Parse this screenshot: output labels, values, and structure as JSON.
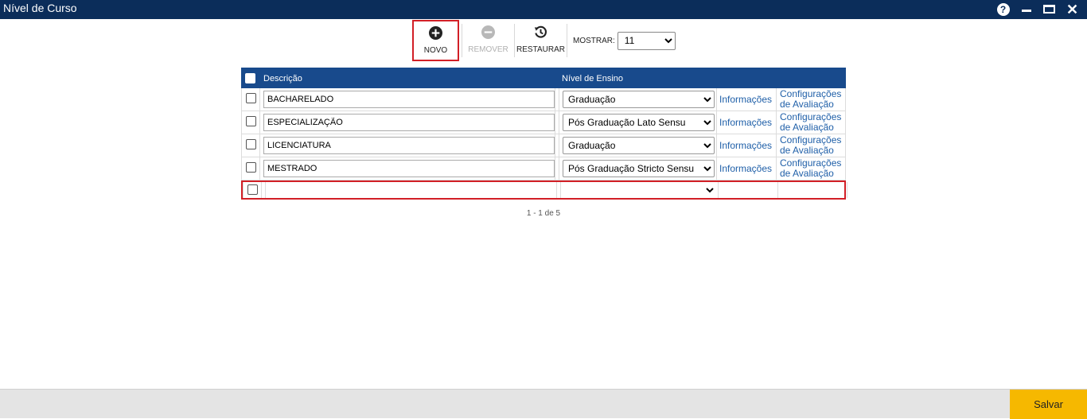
{
  "window": {
    "title": "Nível de Curso",
    "controls": [
      "help-icon",
      "minimize-icon",
      "restore-icon",
      "close-icon"
    ],
    "help_glyph": "?",
    "close_glyph": "✕"
  },
  "toolbar": {
    "new_label": "NOVO",
    "remove_label": "REMOVER",
    "restore_label": "RESTAURAR",
    "show_label": "MOSTRAR:",
    "show_value": "11"
  },
  "grid": {
    "headers": {
      "description": "Descrição",
      "level": "Nível de Ensino"
    },
    "rows": [
      {
        "description": "BACHARELADO",
        "level": "Graduação",
        "info": "Informações",
        "config": "Configurações de Avaliação"
      },
      {
        "description": "ESPECIALIZAÇÃO",
        "level": "Pós Graduação Lato Sensu",
        "info": "Informações",
        "config": "Configurações de Avaliação"
      },
      {
        "description": "LICENCIATURA",
        "level": "Graduação",
        "info": "Informações",
        "config": "Configurações de Avaliação"
      },
      {
        "description": "MESTRADO",
        "level": "Pós Graduação Stricto Sensu",
        "info": "Informações",
        "config": "Configurações de Avaliação"
      }
    ],
    "new_row": {
      "description": "",
      "level": ""
    }
  },
  "pager": {
    "text": "1 - 1 de 5"
  },
  "footer": {
    "save_label": "Salvar"
  },
  "colors": {
    "titlebar": "#0b2d5a",
    "grid_header": "#184a8c",
    "highlight": "#d21f26",
    "link": "#1f5fa8",
    "save_button": "#f6b800"
  }
}
